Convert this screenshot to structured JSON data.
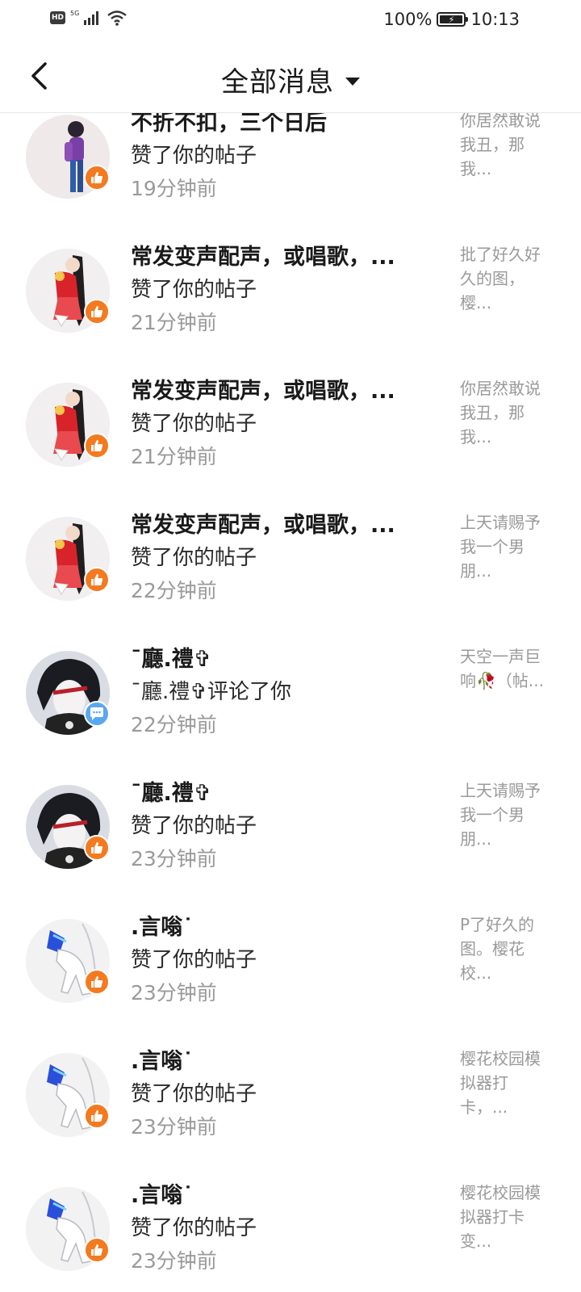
{
  "status_bar": {
    "hd": "HD",
    "network": "5G",
    "battery_percent": "100%",
    "time": "10:13"
  },
  "header": {
    "title": "全部消息"
  },
  "messages": [
    {
      "name": "不折不扣，三个日后",
      "action": "赞了你的帖子",
      "time": "19分钟前",
      "snippet": "你居然敢说我丑，那我...",
      "type": "like",
      "avatar": "purple-figure"
    },
    {
      "name": "常发变声配声，或唱歌，...",
      "action": "赞了你的帖子",
      "time": "21分钟前",
      "snippet": "批了好久好久的图，樱...",
      "type": "like",
      "avatar": "red-figure"
    },
    {
      "name": "常发变声配声，或唱歌，...",
      "action": "赞了你的帖子",
      "time": "21分钟前",
      "snippet": "你居然敢说我丑，那我...",
      "type": "like",
      "avatar": "red-figure"
    },
    {
      "name": "常发变声配声，或唱歌，...",
      "action": "赞了你的帖子",
      "time": "22分钟前",
      "snippet": "上天请赐予我一个男朋...",
      "type": "like",
      "avatar": "red-figure"
    },
    {
      "name": "ˉ廳.禮✞",
      "action": "ˉ廳.禮✞评论了你",
      "time": "22分钟前",
      "snippet": "天空一声巨响🥀（帖...",
      "type": "comment",
      "avatar": "dark-hair"
    },
    {
      "name": "ˉ廳.禮✞",
      "action": "赞了你的帖子",
      "time": "23分钟前",
      "snippet": "上天请赐予我一个男朋...",
      "type": "like",
      "avatar": "dark-hair"
    },
    {
      "name": ".言嗡˙",
      "action": "赞了你的帖子",
      "time": "23分钟前",
      "snippet": "P了好久的图。樱花校...",
      "type": "like",
      "avatar": "blue-hands"
    },
    {
      "name": ".言嗡˙",
      "action": "赞了你的帖子",
      "time": "23分钟前",
      "snippet": "樱花校园模拟器打卡，...",
      "type": "like",
      "avatar": "blue-hands"
    },
    {
      "name": ".言嗡˙",
      "action": "赞了你的帖子",
      "time": "23分钟前",
      "snippet": "樱花校园模拟器打卡变...",
      "type": "like",
      "avatar": "blue-hands"
    }
  ]
}
